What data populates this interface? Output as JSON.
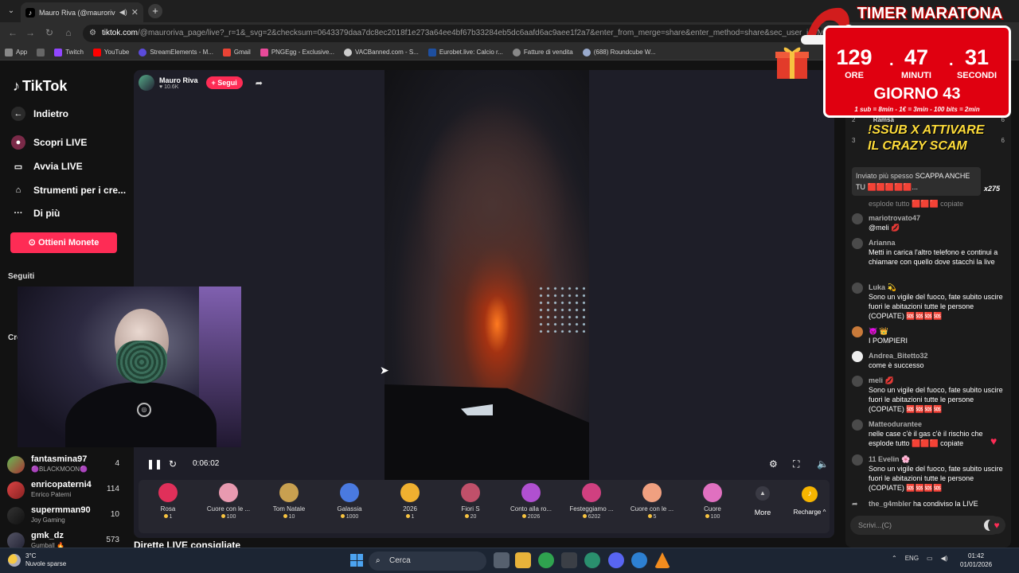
{
  "browser": {
    "tab_title": "Mauro Riva (@mauroriva_p",
    "url_host": "tiktok.com",
    "url_rest": "/@mauroriva_page/live?_r=1&_svg=2&checksum=0643379daa7dc8ec2018f1e273a64ee4bf67b33284eb5dc6aafd6ac9aee1f2a7&enter_from_merge=share&enter_method=share&sec_user_id=MS4wLjABAAA",
    "bookmarks": [
      {
        "label": "App",
        "color": "#888888"
      },
      {
        "label": "",
        "color": "#888888"
      },
      {
        "label": "Twitch",
        "color": "#9146ff"
      },
      {
        "label": "YouTube",
        "color": "#ff0000"
      },
      {
        "label": "StreamElements - M...",
        "color": "#5b4bdb"
      },
      {
        "label": "Gmail",
        "color": "#ea4335"
      },
      {
        "label": "PNGEgg - Exclusive...",
        "color": "#e84a9a"
      },
      {
        "label": "VACBanned.com - S...",
        "color": "#cccccc"
      },
      {
        "label": "Eurobet.live: Calcio r...",
        "color": "#1e4fa0"
      },
      {
        "label": "Fatture di vendita",
        "color": "#888888"
      },
      {
        "label": "(688) Roundcube W...",
        "color": "#9ac"
      }
    ]
  },
  "sidebar": {
    "logo": "TikTok",
    "back": "Indietro",
    "items": [
      {
        "label": "Scopri LIVE"
      },
      {
        "label": "Avvia LIVE"
      },
      {
        "label": "Strumenti per i cre..."
      },
      {
        "label": "Di più"
      }
    ],
    "coins_button": "Ottieni Monete",
    "following_header": "Seguiti",
    "creators_header": "Cre",
    "following": [
      {
        "name": "fantasmina97",
        "sub": "🟣BLACKMOON🟣",
        "count": "4"
      },
      {
        "name": "enricopaterni4",
        "sub": "Enrico Paterni",
        "count": "114"
      },
      {
        "name": "supermman90",
        "sub": "Joy Gaming",
        "count": "10"
      },
      {
        "name": "gmk_dz",
        "sub": "Gumball 🔥",
        "count": "573"
      }
    ]
  },
  "live": {
    "streamer_name": "Mauro Riva",
    "viewers": "♥ 10.6K",
    "follow_label": "+ Segui",
    "elapsed": "0:06:02",
    "suggested": "Dirette LIVE consigliate",
    "gifts": [
      {
        "name": "Rosa",
        "price": "1",
        "color": "#e0305a"
      },
      {
        "name": "Cuore con le ...",
        "price": "100",
        "color": "#e89ab0"
      },
      {
        "name": "Tom Natale",
        "price": "10",
        "color": "#c8a050"
      },
      {
        "name": "Galassia",
        "price": "1000",
        "color": "#4a7ae0"
      },
      {
        "name": "2026",
        "price": "1",
        "color": "#f0b030"
      },
      {
        "name": "Fiori S",
        "price": "20",
        "color": "#c0506a"
      },
      {
        "name": "Conto alla ro...",
        "price": "2026",
        "color": "#b050d0"
      },
      {
        "name": "Festeggiamo ...",
        "price": "6202",
        "color": "#d04080"
      },
      {
        "name": "Cuore con le ...",
        "price": "5",
        "color": "#f0a080"
      },
      {
        "name": "Cuore",
        "price": "100",
        "color": "#e070c0"
      }
    ],
    "more_label": "More",
    "recharge_label": "Recharge ^"
  },
  "chat": {
    "ranks": [
      {
        "pos": "2",
        "name": "Ramsa",
        "score": "6"
      },
      {
        "pos": "3",
        "name": "",
        "score": "6"
      }
    ],
    "goal_text": "!SSUB X ATTIVARE IL CRAZY SCAM",
    "sent_most_title": "Inviato più spesso",
    "sent_most_text": "SCAPPA ANCHE TU 🟥🟥🟥🟥🟥...",
    "sent_most_count": "x275",
    "partial_text": "esplode tutto 🟥🟥🟥 copiate",
    "messages": [
      {
        "user": "mariotrovato47",
        "text": "@meli 💋"
      },
      {
        "user": "Arianna",
        "text": "Metti in carica l'altro telefono e continui a chiamare con quello dove stacchi la live"
      },
      {
        "user": "Luka 💫",
        "text": "Sono un vigile del fuoco, fate subito uscire fuori le abitazioni tutte le persone (COPIATE) 🆘🆘🆘🆘"
      },
      {
        "user": "😈 👑",
        "text": "I POMPIERI"
      },
      {
        "user": "Andrea_Bitetto32",
        "text": "come è successo"
      },
      {
        "user": "meli 💋",
        "text": "Sono un vigile del fuoco, fate subito uscire fuori le abitazioni tutte le persone (COPIATE) 🆘🆘🆘🆘"
      },
      {
        "user": "Matteodurantee",
        "text": "nelle case c'è il gas c'è il rischio che esplode tutto 🟥🟥🟥 copiate"
      },
      {
        "user": "11 Evelin 🌸",
        "text": "Sono un vigile del fuoco, fate subito uscire fuori le abitazioni tutte le persone (COPIATE) 🆘🆘🆘🆘"
      }
    ],
    "share_user": "the_g4mbler",
    "share_text": "ha condiviso la LIVE",
    "input_placeholder": "Scrivi...(C)"
  },
  "timer": {
    "title": "TIMER MARATONA",
    "hours": "129",
    "hours_label": "ORE",
    "minutes": "47",
    "minutes_label": "MINUTI",
    "seconds": "31",
    "seconds_label": "SECONDI",
    "day": "GIORNO 43",
    "rates": "1 sub = 8min - 1€ = 3min - 100 bits = 2min"
  },
  "taskbar": {
    "temp": "3°C",
    "weather": "Nuvole sparse",
    "search": "Cerca",
    "lang": "ENG",
    "time": "01:42",
    "date": "01/01/2026"
  }
}
